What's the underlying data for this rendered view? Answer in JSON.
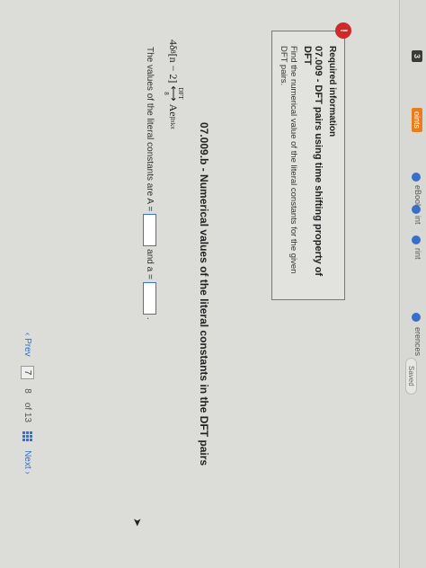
{
  "sidebar": {
    "item_1": "3",
    "item_2": "oints",
    "item_3": "eBook",
    "item_4": "int",
    "item_5": "rint",
    "item_6": "erences"
  },
  "toolbar": {
    "save_label": "Saved"
  },
  "info": {
    "badge": "!",
    "label": "Required information",
    "title": "07.009 - DFT pairs using time shifting property of DFT",
    "text": "Find the numerical value of the literal constants for the given DFT pairs."
  },
  "question": {
    "title": "07.009.b - Numerical values of the literal constants in the DFT pairs",
    "pair_left": "4δ",
    "pair_left_sub": "8",
    "pair_left_arg": "[n − 2]",
    "pair_arrow_top": "DFT",
    "pair_arrow_bottom": "8",
    "pair_right": "Ae",
    "pair_right_exp": "βπkπ",
    "answer_prefix": "The values of the literal constants are A =",
    "answer_mid": "and a =",
    "answer_suffix": "."
  },
  "nav": {
    "prev_label": "Prev",
    "page_current": "7",
    "page_sep": "8",
    "page_of": "of 13",
    "next_label": "Next"
  },
  "colors": {
    "accent": "#3a6fc9",
    "badge": "#cf2a2a",
    "answer_border": "#3a76c5"
  }
}
